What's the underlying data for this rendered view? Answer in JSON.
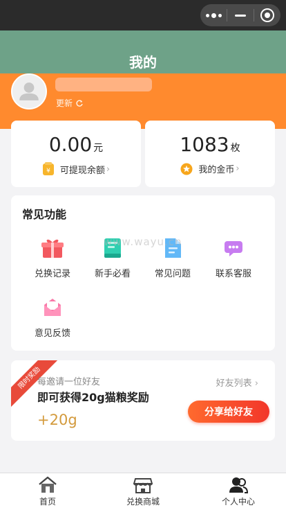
{
  "header": {
    "title": "我的"
  },
  "profile": {
    "refresh_label": "更新"
  },
  "balance_card": {
    "amount": "0.00",
    "unit": "元",
    "link_label": "可提现余额"
  },
  "coins_card": {
    "amount": "1083",
    "unit": "枚",
    "link_label": "我的金币"
  },
  "functions": {
    "title": "常见功能",
    "items": [
      {
        "label": "兑换记录",
        "icon": "gift-icon"
      },
      {
        "label": "新手必看",
        "icon": "book-icon"
      },
      {
        "label": "常见问题",
        "icon": "document-icon"
      },
      {
        "label": "联系客服",
        "icon": "chat-icon"
      },
      {
        "label": "意见反馈",
        "icon": "envelope-icon"
      }
    ]
  },
  "watermark": "www.wayu.cn",
  "invite": {
    "ribbon": "限时奖励",
    "subtitle": "每邀请一位好友",
    "title": "即可获得20g猫粮奖励",
    "points": "+20g",
    "friends_link": "好友列表",
    "share_button": "分享给好友"
  },
  "tabbar": {
    "items": [
      {
        "label": "首页",
        "icon": "home-icon"
      },
      {
        "label": "兑换商城",
        "icon": "shop-icon"
      },
      {
        "label": "个人中心",
        "icon": "user-icon",
        "active": true
      }
    ]
  },
  "colors": {
    "nav": "#6ea288",
    "band": "#ff8a2e",
    "accent": "#f2362a",
    "points": "#d39a3c"
  }
}
